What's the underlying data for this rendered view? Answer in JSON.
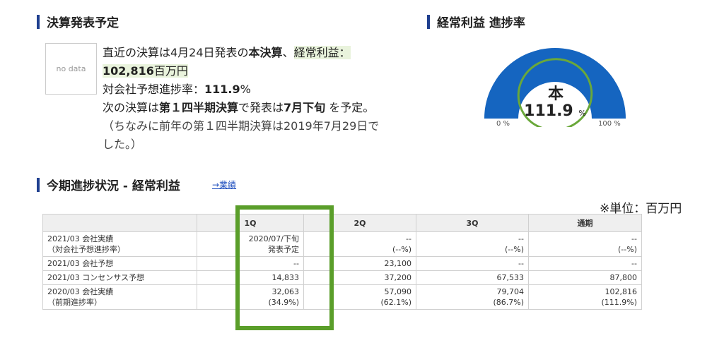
{
  "kessan_section": {
    "title": "決算発表予定",
    "nodata": "no data",
    "line1_a": "直近の決算は4月24日発表の",
    "line1_b": "本決算",
    "line1_c": "、",
    "line1_d": "経常利益：",
    "line1_e": "102,816",
    "line1_f": "百万円",
    "line2_a": "対会社予想進捗率：",
    "line2_b": "111.9",
    "line2_c": "%",
    "line3_a": "次の決算は",
    "line3_b": "第１四半期決算",
    "line3_c": "で発表は",
    "line3_d": "7月下旬",
    "line3_e": " を予定。",
    "line4": "（ちなみに前年の第１四半期決算は2019年7月29日でした。）"
  },
  "progress_section": {
    "title": "経常利益 進捗率",
    "label_hon": "本",
    "value": "111.9",
    "pct": "%",
    "min_label": "0 %",
    "max_label": "100 %",
    "progress_percent": 111.9,
    "gauge_color": "#1565c0"
  },
  "status_section": {
    "title": "今期進捗状況 - 経常利益",
    "link": "→業績",
    "unit": "※単位：百万円"
  },
  "table": {
    "headers": [
      "",
      "1Q",
      "2Q",
      "3Q",
      "通期"
    ],
    "rows": [
      {
        "label": [
          "2021/03 会社実績",
          "（対会社予想進捗率）"
        ],
        "cells": [
          [
            "2020/07/下旬",
            "発表予定"
          ],
          [
            "--",
            "(--%)"
          ],
          [
            "--",
            "(--%)"
          ],
          [
            "--",
            "(--%)"
          ]
        ]
      },
      {
        "label": [
          "2021/03 会社予想"
        ],
        "cells": [
          [
            "--"
          ],
          [
            "23,100"
          ],
          [
            "--"
          ],
          [
            "--"
          ]
        ]
      },
      {
        "label": [
          "2021/03 コンセンサス予想"
        ],
        "cells": [
          [
            "14,833"
          ],
          [
            "37,200"
          ],
          [
            "67,533"
          ],
          [
            "87,800"
          ]
        ]
      },
      {
        "label": [
          "2020/03 会社実績",
          "（前期進捗率）"
        ],
        "cells": [
          [
            "32,063",
            "(34.9%)"
          ],
          [
            "57,090",
            "(62.1%)"
          ],
          [
            "79,704",
            "(86.7%)"
          ],
          [
            "102,816",
            "(111.9%)"
          ]
        ]
      }
    ]
  },
  "highlight_color": "#5a9e2a"
}
